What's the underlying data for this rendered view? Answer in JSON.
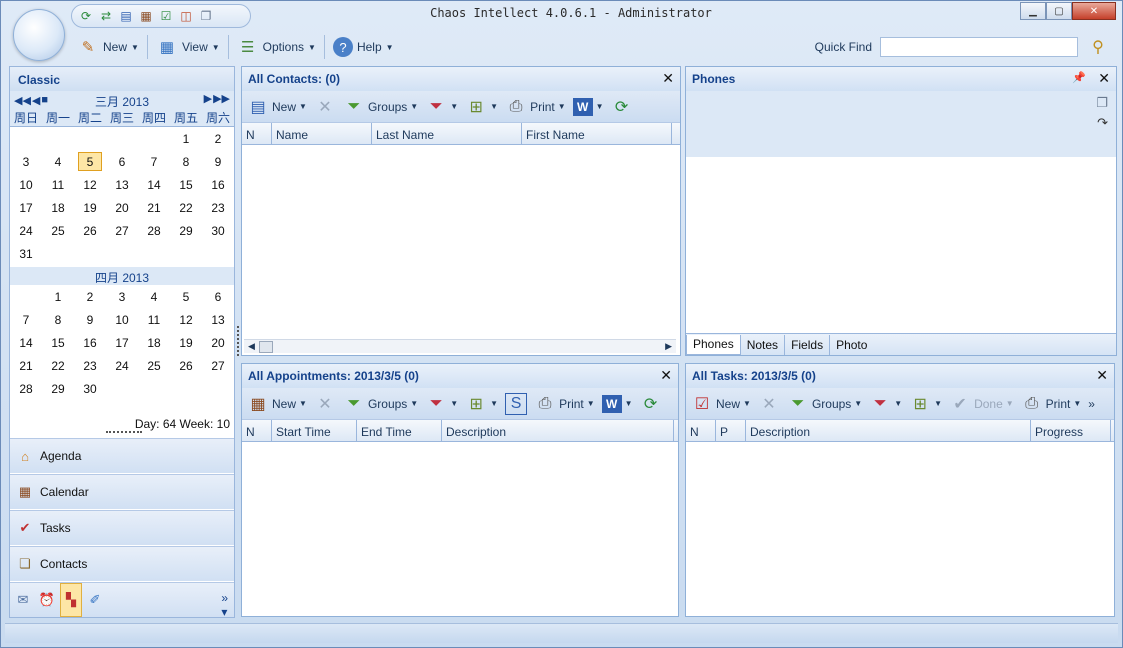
{
  "window": {
    "title": "Chaos Intellect 4.0.6.1 - Administrator",
    "min_icon": "minimize-icon",
    "max_icon": "maximize-icon",
    "close_icon": "close-icon"
  },
  "quick_access": [
    "refresh-icon",
    "sync-icon",
    "new-contact-icon",
    "calendar-icon",
    "task-icon",
    "appointment-icon",
    "copy-icon"
  ],
  "ribbon": {
    "new_label": "New",
    "view_label": "View",
    "options_label": "Options",
    "help_label": "Help"
  },
  "quickfind": {
    "label": "Quick Find",
    "value": ""
  },
  "sidebar": {
    "title": "Classic",
    "month1_title": "三月 2013",
    "weekdays": [
      "周日",
      "周一",
      "周二",
      "周三",
      "周四",
      "周五",
      "周六"
    ],
    "month1_days": [
      "",
      "",
      "",
      "",
      "",
      "1",
      "2",
      "3",
      "4",
      "5",
      "6",
      "7",
      "8",
      "9",
      "10",
      "11",
      "12",
      "13",
      "14",
      "15",
      "16",
      "17",
      "18",
      "19",
      "20",
      "21",
      "22",
      "23",
      "24",
      "25",
      "26",
      "27",
      "28",
      "29",
      "30",
      "31"
    ],
    "today": "5",
    "month2_title": "四月 2013",
    "month2_days": [
      "",
      "1",
      "2",
      "3",
      "4",
      "5",
      "6",
      "7",
      "8",
      "9",
      "10",
      "11",
      "12",
      "13",
      "14",
      "15",
      "16",
      "17",
      "18",
      "19",
      "20",
      "21",
      "22",
      "23",
      "24",
      "25",
      "26",
      "27",
      "28",
      "29",
      "30"
    ],
    "day_week": "Day: 64  Week: 10",
    "nav": [
      {
        "label": "Agenda",
        "icon": "agenda-icon"
      },
      {
        "label": "Calendar",
        "icon": "calendar-icon"
      },
      {
        "label": "Tasks",
        "icon": "tasks-icon"
      },
      {
        "label": "Contacts",
        "icon": "contacts-icon"
      }
    ]
  },
  "contacts": {
    "title": "All Contacts:  (0)",
    "new_label": "New",
    "groups_label": "Groups",
    "print_label": "Print",
    "columns": [
      "N",
      "Name",
      "Last Name",
      "First Name"
    ]
  },
  "phones": {
    "title": "Phones",
    "tabs": [
      "Phones",
      "Notes",
      "Fields",
      "Photo"
    ]
  },
  "appointments": {
    "title": "All Appointments: 2013/3/5  (0)",
    "new_label": "New",
    "groups_label": "Groups",
    "print_label": "Print",
    "columns": [
      "N",
      "Start Time",
      "End Time",
      "Description"
    ]
  },
  "tasks": {
    "title": "All Tasks: 2013/3/5  (0)",
    "new_label": "New",
    "groups_label": "Groups",
    "done_label": "Done",
    "print_label": "Print",
    "columns": [
      "N",
      "P",
      "Description",
      "Progress"
    ]
  }
}
